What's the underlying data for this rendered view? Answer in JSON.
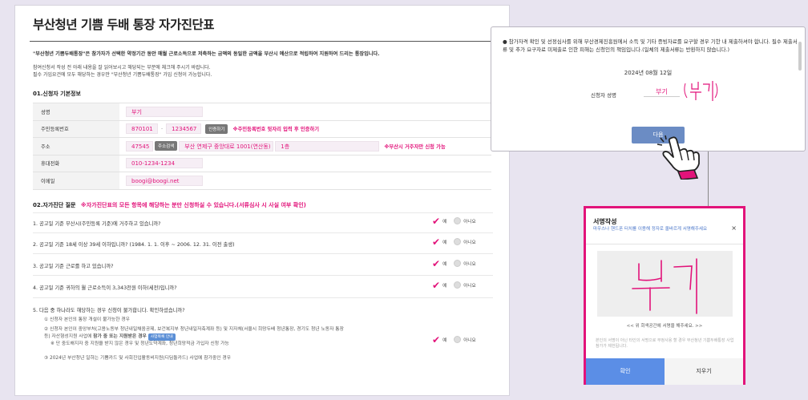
{
  "form": {
    "title": "부산청년 기쁨 두배 통장 자가진단표",
    "intro_bold": "\"부산청년 기쁨두배통장\"은 참가자가 선택한 약정기간 동안 매월 근로소득으로 저축하는 금액의 동일한 금액을 부산시 예산으로 적립하여 지원하여 드리는 통장입니다.",
    "intro_line1": "참여신청서 작성 전 아래 내용을 잘 읽어보시고 해당되는 부분에 체크해 주시기 바랍니다.",
    "intro_line2": "필수 가입요건에 모두 해당하는 경우만 \"부산청년 기쁨두배통장\" 가입 신청이 가능합니다.",
    "section1_title": "01.신청자 기본정보",
    "rows": {
      "name_label": "성명",
      "name_value": "부기",
      "rrn_label": "주민등록번호",
      "rrn_front": "870101",
      "rrn_back": "1234567",
      "verify_btn": "인증하기",
      "rrn_hint": "※주민등록번호 뒷자리 입력 후 인증하기",
      "addr_label": "주소",
      "zip": "47545",
      "addr_search_btn": "주소검색",
      "addr_value": "부산 연제구 중앙대로 1001(연산동)",
      "addr_detail": "1층",
      "addr_hint": "※부산시 거주자만 신청 가능",
      "phone_label": "휴대전화",
      "phone_value": "010-1234-1234",
      "email_label": "이메일",
      "email_value": "boogi@boogi.net"
    },
    "section2_title": "02.자가진단 질문",
    "section2_hint": "※자가진단표의 모든 항목에 해당하는 분만 신청하실 수 있습니다.(서류심사 시 사실 여부 확인)",
    "yes_label": "예",
    "no_label": "아니요",
    "questions": [
      "1. 공고일 기준 부산시(주민등록 기준)에 거주하고 있습니까?",
      "2. 공고일 기준 18세 이상 39세 이하입니까? (1984. 1. 1. 이후 ~ 2006. 12. 31. 이전 출생)",
      "3. 공고일 기준 근로를 하고 있습니까?",
      "4. 공고일 기준 귀하의 월 근로소득이 3,343천원 이하(세전)입니까?",
      "5. 다음 중 하나라도 해당하는 경우 신청이 불가합니다. 확인하셨습니까?"
    ],
    "q5_items": {
      "a": "① 신청자 본인의 통장 개설이 불가능한 경우",
      "b1": "② 신청자 본인이 중앙부처(고용노동부 청년내일채움공제, 보건복지부 청년내일저축계좌 등) 및 지자체(서울시 희망두배 청년통장, 경기도 청년 노동자 통장",
      "b2_pre": "등) 자산형성지원 사업에 ",
      "b2_bold": "참가 중 또는 지원받은 경우",
      "badge": "사업목록 안내",
      "b3": "※ 단 중도해지자 중 지원을 받지 않은 경우 및 청년도약계좌, 청년희망적금 가입자 신청 가능",
      "c": "③ 2024년 부산청년 일하는 기쁨카드 및 사회진입활동비지원(디딤돌카드) 사업에 참가중인 경우"
    }
  },
  "notice": {
    "text": "● 참가자격 확인 및 선정심사를 위해 부산경제진흥원에서 소득 및 기타 증빙자료를 요구할 경우 기한 내 제출하셔야 합니다. 필수 제출서류 및 추가 요구자료 미제출로 인한 피해는 신청인의 책임입니다.(일체의 제출서류는 반환하지 않습니다.)",
    "date": "2024년 08월 12일",
    "signer_label": "신청자 성명",
    "signer_name": "부기",
    "next_btn": "다음"
  },
  "dialog": {
    "title": "서명작성",
    "close": "×",
    "subtitle": "마우스나 핸드폰 터치를 이용해 정자로 올바르게 서명해주세요",
    "pad_hint": "<< 위 회색공간에 서명을 해주세요. >>",
    "warning": "본인의 서명이 아닌 타인의 서명으로 부정사용 할 경우 부산청년 기쁨두배통장 사업 참가가 제한됩니다.",
    "confirm_btn": "확인",
    "erase_btn": "지우기"
  },
  "colors": {
    "accent": "#e2137a",
    "button_blue": "#5b8ee6"
  }
}
